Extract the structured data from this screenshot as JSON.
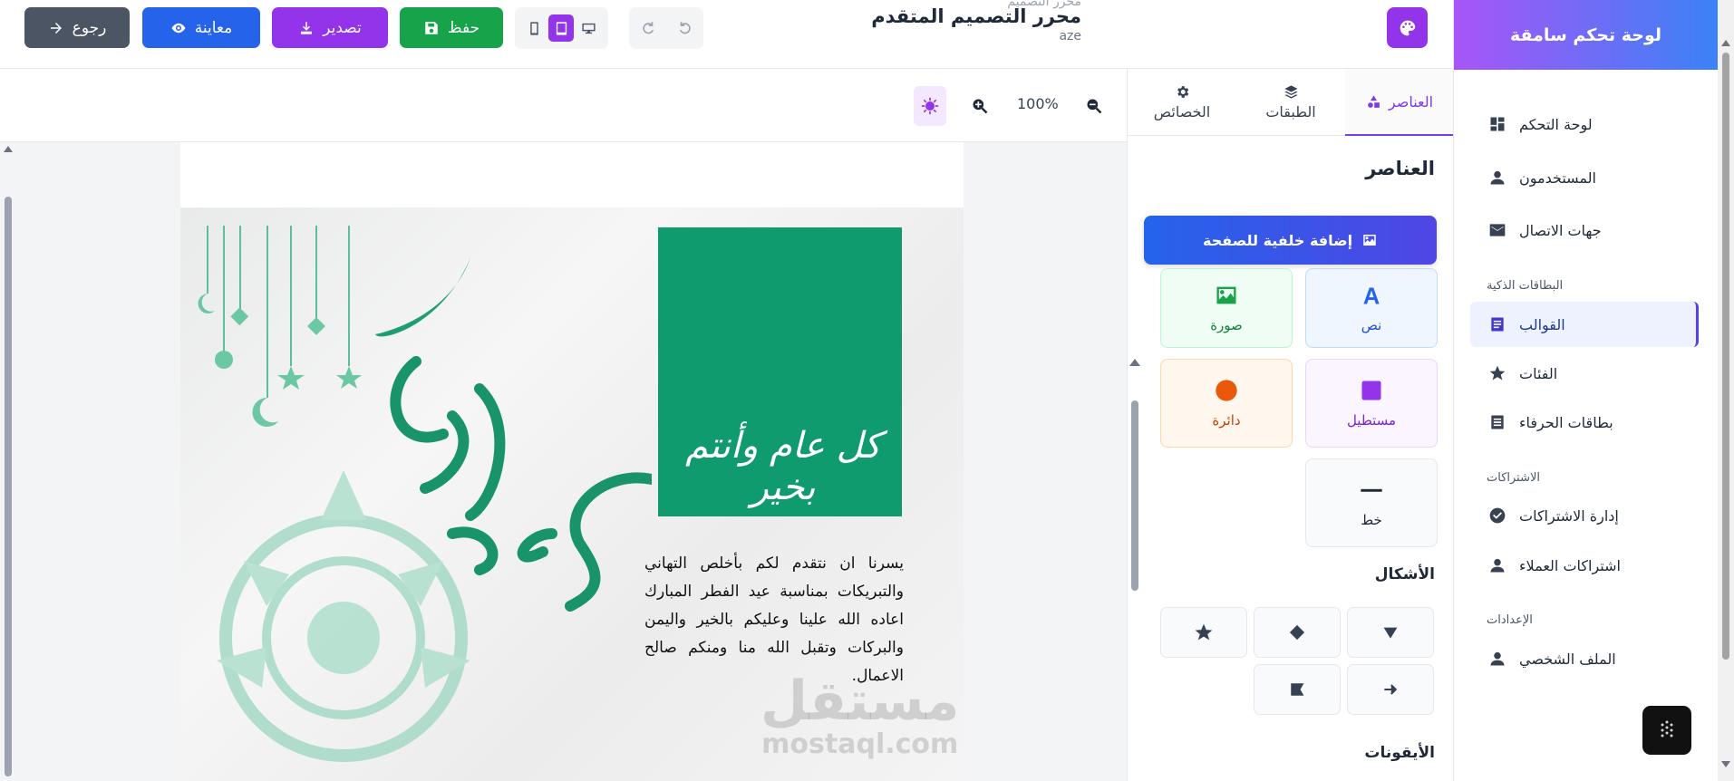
{
  "header": {
    "ghost_text": "محرر التصميم",
    "title": "محرر التصميم المتقدم",
    "subtitle": "aze",
    "buttons": {
      "back": "رجوع",
      "preview": "معاينة",
      "export": "تصدير",
      "save": "حفظ"
    },
    "devices": [
      "mobile-icon",
      "tablet-icon",
      "desktop-icon"
    ],
    "active_device": "tablet"
  },
  "admin": {
    "brand": "لوحة تحكم سامقة",
    "items": [
      {
        "label": "لوحة التحكم",
        "icon": "dashboard-icon"
      },
      {
        "label": "المستخدمون",
        "icon": "user-icon"
      },
      {
        "label": "جهات الاتصال",
        "icon": "mail-icon"
      }
    ],
    "section_cards": "البطاقات الذكية",
    "cards_items": [
      {
        "label": "القوالب",
        "icon": "document-icon",
        "active": true
      },
      {
        "label": "الفئات",
        "icon": "star-icon"
      },
      {
        "label": "بطاقات الحرفاء",
        "icon": "list-icon"
      }
    ],
    "section_subs": "الاشتراكات",
    "subs_items": [
      {
        "label": "إدارة الاشتراكات",
        "icon": "check-circle-icon"
      },
      {
        "label": "اشتراكات العملاء",
        "icon": "user-icon"
      }
    ],
    "section_settings": "الإعدادات",
    "settings_items": [
      {
        "label": "الملف الشخصي",
        "icon": "user-icon"
      }
    ]
  },
  "panel": {
    "tabs": {
      "elements": "العناصر",
      "layers": "الطبقات",
      "properties": "الخصائص"
    },
    "heading": "العناصر",
    "add_background": "إضافة خلفية للصفحة",
    "tiles": {
      "text": "نص",
      "image": "صورة",
      "rectangle": "مستطيل",
      "circle": "دائرة",
      "line": "خط"
    },
    "shapes_title": "الأشكال",
    "icons_title": "الأيقونات",
    "colors": {
      "text": "#2563eb",
      "image": "#16a34a",
      "rectangle": "#9333ea",
      "circle": "#ea580c"
    }
  },
  "canvas": {
    "zoom": "100%",
    "greeting": "يسرنا ان نتقدم لكم بأخلص التهاني والتبريكات بمناسبة عيد الفطر المبارك اعاده الله علينا وعليكم بالخير واليمن والبركات وتقبل الله منا ومنكم صالح الاعمال.",
    "calligraphy_box": "كل عام وأنتم بخير",
    "calligraphy_main": "عيد مبارك",
    "watermark_ar": "مستقل",
    "watermark_en": "mostaql.com",
    "accent": "#0f9b6e"
  }
}
